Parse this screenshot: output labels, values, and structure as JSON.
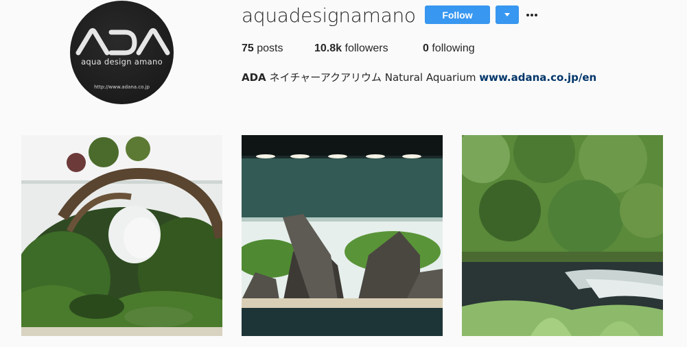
{
  "profile": {
    "username": "aquadesignamano",
    "avatar": {
      "logo_text": "ADA",
      "tagline": "aqua design amano",
      "url": "http://www.adana.co.jp"
    },
    "follow_label": "Follow",
    "more_icon": "ellipsis-icon",
    "dropdown_icon": "caret-down-icon",
    "stats": {
      "posts_count": "75",
      "posts_label": "posts",
      "followers_count": "10.8k",
      "followers_label": "followers",
      "following_count": "0",
      "following_label": "following"
    },
    "bio": {
      "name": "ADA",
      "text": "ネイチャーアクアリウム Natural Aquarium",
      "link": "www.adana.co.jp/en"
    },
    "accent_color": "#3897f0",
    "link_color": "#003569"
  },
  "posts": [
    {
      "subject": "aquascape with driftwood arch"
    },
    {
      "subject": "iwagumi rock aquascape under lights"
    },
    {
      "subject": "forest stream with ferns"
    }
  ]
}
